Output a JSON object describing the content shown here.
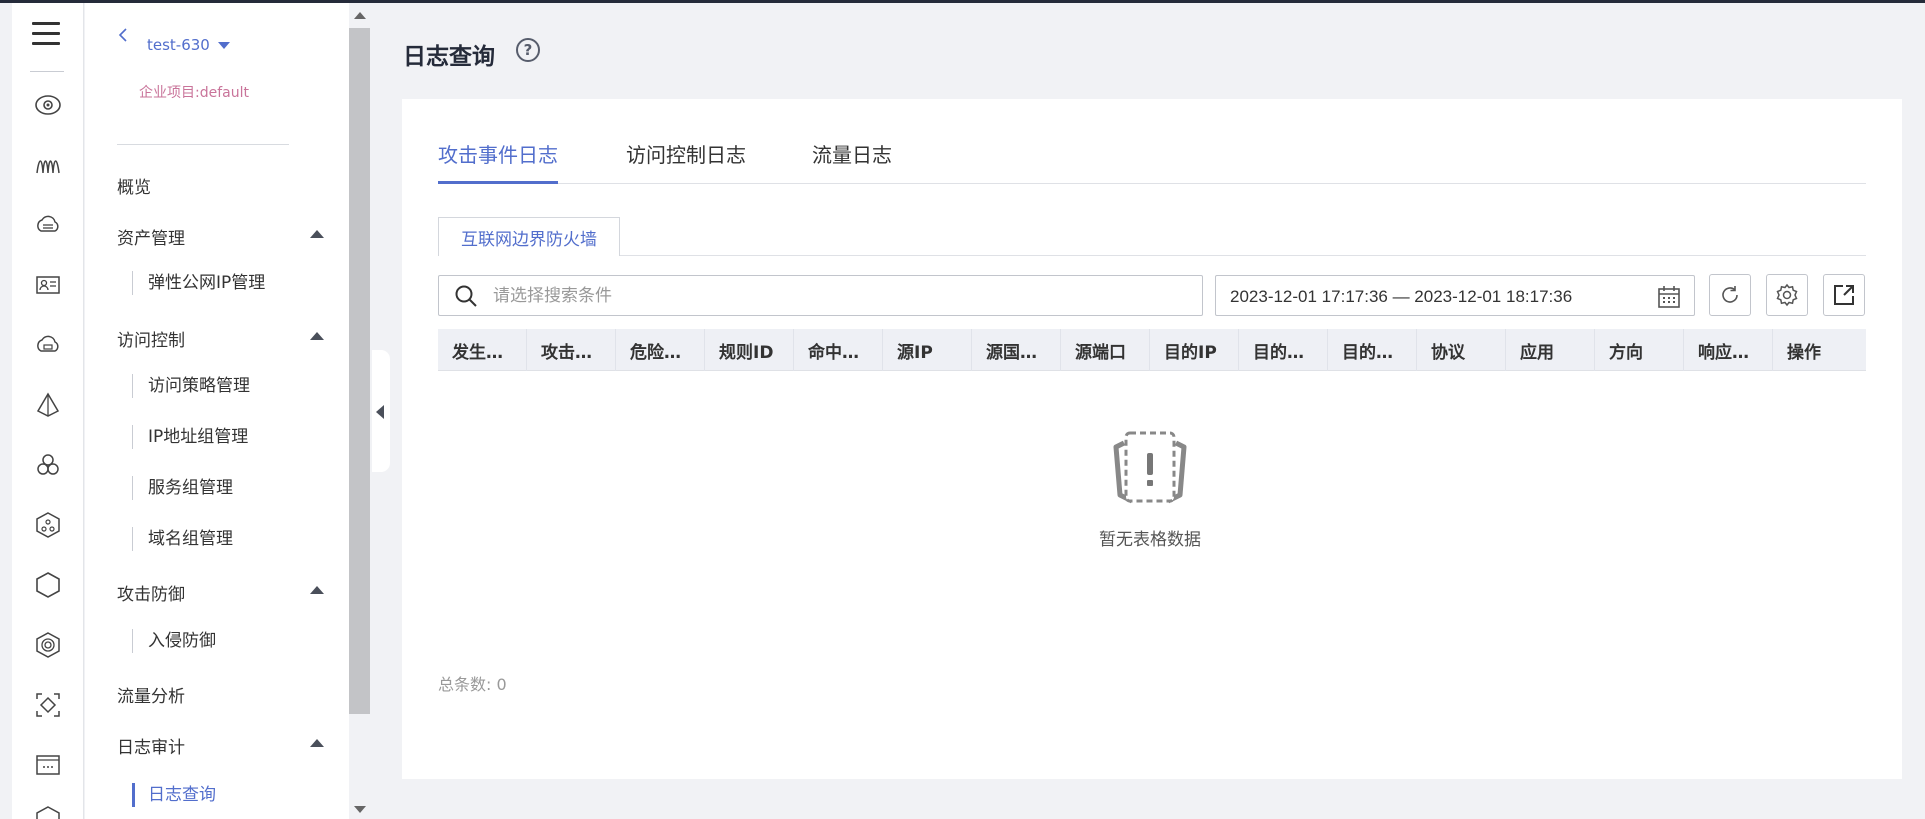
{
  "app": {
    "page_title": "日志查询"
  },
  "nav": {
    "back_icon": "chevron-left-icon",
    "instance": "test-630",
    "project": "企业项目:default",
    "items": [
      {
        "label": "概览"
      },
      {
        "label": "资产管理"
      },
      {
        "label": "弹性公网IP管理"
      },
      {
        "label": "访问控制"
      },
      {
        "label": "访问策略管理"
      },
      {
        "label": "IP地址组管理"
      },
      {
        "label": "服务组管理"
      },
      {
        "label": "域名组管理"
      },
      {
        "label": "攻击防御"
      },
      {
        "label": "入侵防御"
      },
      {
        "label": "流量分析"
      },
      {
        "label": "日志审计"
      },
      {
        "label": "日志查询"
      }
    ]
  },
  "rail": {
    "icons": [
      "menu-icon",
      "eye-icon",
      "waves-icon",
      "cloud-storage-icon",
      "id-card-icon",
      "cloud-icon",
      "pyramid-icon",
      "cluster-icon",
      "hex-network-icon",
      "hexagon-icon",
      "shield-hex-icon",
      "diamond-box-icon",
      "terminal-icon",
      "more-icon"
    ]
  },
  "tabs": [
    {
      "label": "攻击事件日志",
      "active": true
    },
    {
      "label": "访问控制日志",
      "active": false
    },
    {
      "label": "流量日志",
      "active": false
    }
  ],
  "subtab": {
    "label": "互联网边界防火墙"
  },
  "search": {
    "placeholder": "请选择搜索条件",
    "value": ""
  },
  "date_range": {
    "text": "2023-12-01 17:17:36 — 2023-12-01 18:17:36"
  },
  "table": {
    "columns": [
      "发生…",
      "攻击…",
      "危险…",
      "规则ID",
      "命中…",
      "源IP",
      "源国…",
      "源端口",
      "目的IP",
      "目的…",
      "目的…",
      "协议",
      "应用",
      "方向",
      "响应…",
      "操作"
    ],
    "rows": [],
    "empty_text": "暂无表格数据"
  },
  "footer": {
    "total_label": "总条数:",
    "total_value": "0"
  },
  "colors": {
    "accent": "#526ecc",
    "project": "#c9749a",
    "header_bg": "#eef0f5",
    "page_bg": "#f1f2f5"
  }
}
